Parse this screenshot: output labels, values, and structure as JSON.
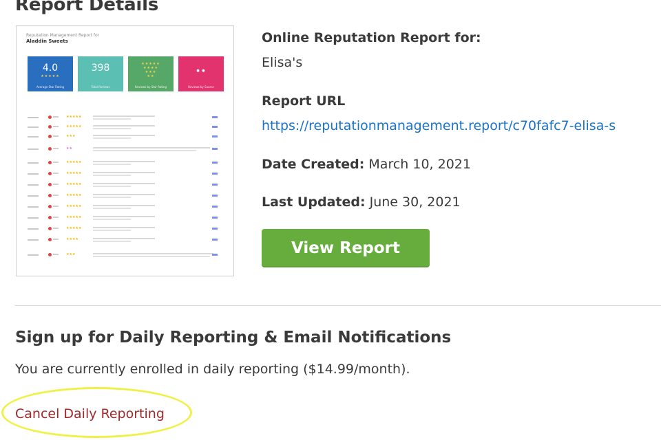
{
  "section_title": "Report Details",
  "thumbnail": {
    "header_line1": "Reputation Management Report for",
    "header_line2": "Aladdin Sweets",
    "tiles": [
      {
        "value": "4.0",
        "label": "Average Star Rating",
        "color": "#2a6fbf"
      },
      {
        "value": "398",
        "label": "Total Reviews",
        "color": "#5bbfb3"
      },
      {
        "value": "",
        "label": "Reviews by Star Rating",
        "color": "#56a868"
      },
      {
        "value": "",
        "label": "Reviews by Source",
        "color": "#e2336f"
      }
    ]
  },
  "details": {
    "report_for_label": "Online Reputation Report for:",
    "report_for_value": "Elisa's",
    "url_label": "Report URL",
    "url_value": "https://reputationmanagement.report/c70fafc7-elisa-s",
    "date_created_label": "Date Created:",
    "date_created_value": " March 10, 2021",
    "last_updated_label": "Last Updated:",
    "last_updated_value": " June 30, 2021"
  },
  "view_button_label": "View Report",
  "daily": {
    "heading": "Sign up for Daily Reporting & Email Notifications",
    "status_text": "You are currently enrolled in daily reporting ($14.99/month).",
    "cancel_link": "Cancel Daily Reporting"
  },
  "colors": {
    "button_green": "#67ad3e",
    "link_blue": "#1a73c9",
    "cancel_red": "#a0282b",
    "highlight_yellow": "#f0f046"
  }
}
